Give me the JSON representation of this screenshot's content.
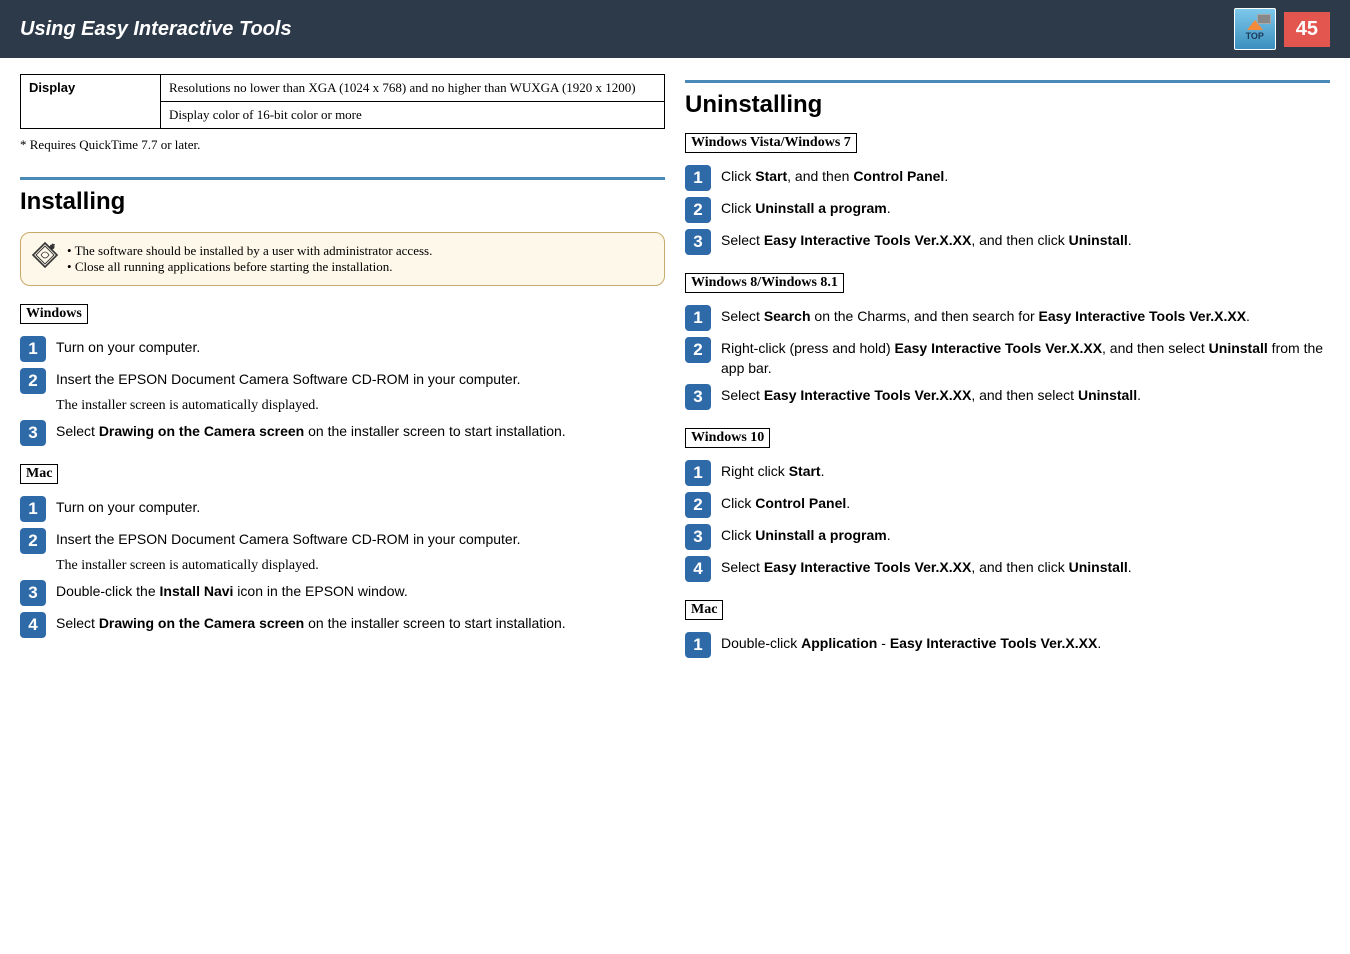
{
  "header": {
    "title": "Using Easy Interactive Tools",
    "topLabel": "TOP",
    "pageNumber": "45"
  },
  "table": {
    "displayLabel": "Display",
    "row1": "Resolutions no lower than XGA (1024 x 768) and no higher than WUXGA (1920 x 1200)",
    "row2": "Display color of 16-bit color or more"
  },
  "footnote": "* Requires QuickTime 7.7 or later.",
  "installing": {
    "title": "Installing",
    "tip1": "The software should be installed by a user with administrator access.",
    "tip2": "Close all running applications before starting the installation.",
    "winLabel": "Windows",
    "macLabel": "Mac",
    "winSteps": {
      "s1": "Turn on your computer.",
      "s2": "Insert the EPSON Document Camera Software CD-ROM in your computer.",
      "s2sub": "The installer screen is automatically displayed.",
      "s3a": "Select ",
      "s3b": "Drawing on the Camera screen",
      "s3c": " on the installer screen to start installation."
    },
    "macSteps": {
      "s1": "Turn on your computer.",
      "s2": "Insert the EPSON Document Camera Software CD-ROM in your computer.",
      "s2sub": "The installer screen is automatically displayed.",
      "s3a": "Double-click the ",
      "s3b": "Install Navi",
      "s3c": " icon in the EPSON window.",
      "s4a": "Select ",
      "s4b": "Drawing on the Camera screen",
      "s4c": " on the installer screen to start installation."
    }
  },
  "uninstalling": {
    "title": "Uninstalling",
    "vistaLabel": "Windows Vista/Windows 7",
    "vista": {
      "s1a": "Click ",
      "s1b": "Start",
      "s1c": ", and then ",
      "s1d": "Control Panel",
      "s1e": ".",
      "s2a": "Click ",
      "s2b": "Uninstall a program",
      "s2c": ".",
      "s3a": "Select ",
      "s3b": "Easy Interactive Tools Ver.X.XX",
      "s3c": ", and then click ",
      "s3d": "Uninstall",
      "s3e": "."
    },
    "win8Label": "Windows 8/Windows 8.1",
    "win8": {
      "s1a": "Select ",
      "s1b": "Search",
      "s1c": " on the Charms, and then search for ",
      "s1d": "Easy Interactive Tools Ver.X.XX",
      "s1e": ".",
      "s2a": "Right-click (press and hold) ",
      "s2b": "Easy Interactive Tools Ver.X.XX",
      "s2c": ", and then select ",
      "s2d": "Uninstall",
      "s2e": " from the app bar.",
      "s3a": "Select ",
      "s3b": "Easy Interactive Tools Ver.X.XX",
      "s3c": ", and then select ",
      "s3d": "Uninstall",
      "s3e": "."
    },
    "win10Label": "Windows 10",
    "win10": {
      "s1a": "Right click ",
      "s1b": "Start",
      "s1c": ".",
      "s2a": "Click ",
      "s2b": "Control Panel",
      "s2c": ".",
      "s3a": "Click ",
      "s3b": "Uninstall a program",
      "s3c": ".",
      "s4a": "Select ",
      "s4b": "Easy Interactive Tools Ver.X.XX",
      "s4c": ", and then click ",
      "s4d": "Uninstall",
      "s4e": "."
    },
    "macLabel": "Mac",
    "mac": {
      "s1a": "Double-click ",
      "s1b": "Application",
      "s1c": " - ",
      "s1d": "Easy Interactive Tools Ver.X.XX",
      "s1e": "."
    }
  }
}
